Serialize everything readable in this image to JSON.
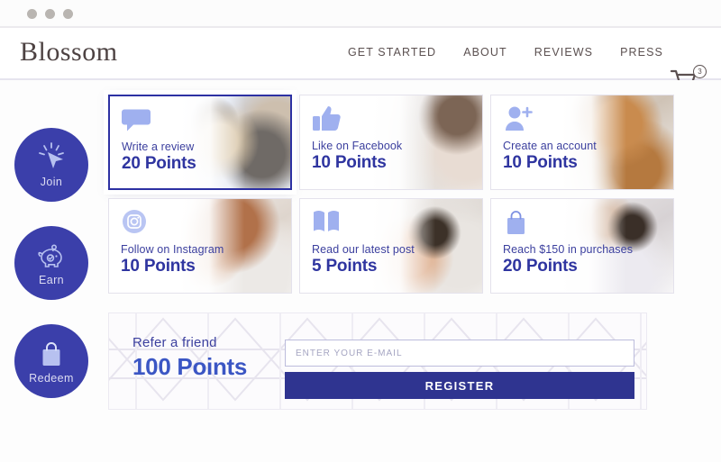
{
  "browser": {
    "dots": [
      "close-dot",
      "minimize-dot",
      "maximize-dot"
    ]
  },
  "header": {
    "logo": "Blossom",
    "nav": [
      {
        "label": "GET STARTED"
      },
      {
        "label": "ABOUT"
      },
      {
        "label": "REVIEWS"
      },
      {
        "label": "PRESS"
      }
    ],
    "cart": {
      "icon": "shopping-cart-icon",
      "count": "3"
    }
  },
  "rail": [
    {
      "label": "Join",
      "icon": "cursor-click-icon"
    },
    {
      "label": "Earn",
      "icon": "piggy-bank-icon"
    },
    {
      "label": "Redeem",
      "icon": "shopping-bag-icon"
    }
  ],
  "cards": [
    {
      "title": "Write a review",
      "points": "20 Points",
      "icon": "speech-bubble-icon",
      "photo": "ph-dogs",
      "selected": true
    },
    {
      "title": "Like on Facebook",
      "points": "10 Points",
      "icon": "thumbs-up-icon",
      "photo": "ph-pillow",
      "selected": false
    },
    {
      "title": "Create an account",
      "points": "10 Points",
      "icon": "add-user-icon",
      "photo": "ph-cat",
      "selected": false
    },
    {
      "title": "Follow on Instagram",
      "points": "10 Points",
      "icon": "instagram-icon",
      "photo": "ph-sweater",
      "selected": false
    },
    {
      "title": "Read our latest post",
      "points": "5 Points",
      "icon": "open-book-icon",
      "photo": "ph-arm",
      "selected": false
    },
    {
      "title": "Reach $150 in purchases",
      "points": "20 Points",
      "icon": "shopping-bag-icon",
      "photo": "ph-couple",
      "selected": false
    }
  ],
  "referral": {
    "title": "Refer a friend",
    "points": "100 Points",
    "email_placeholder": "ENTER YOUR E-MAIL",
    "email_value": "",
    "register_label": "REGISTER"
  },
  "colors": {
    "brand_indigo": "#3b3faa",
    "deep_indigo": "#2f3490",
    "card_title": "#3b3f9e",
    "icon_blue": "#a8b6ef",
    "logo_brown": "#4d4242"
  }
}
